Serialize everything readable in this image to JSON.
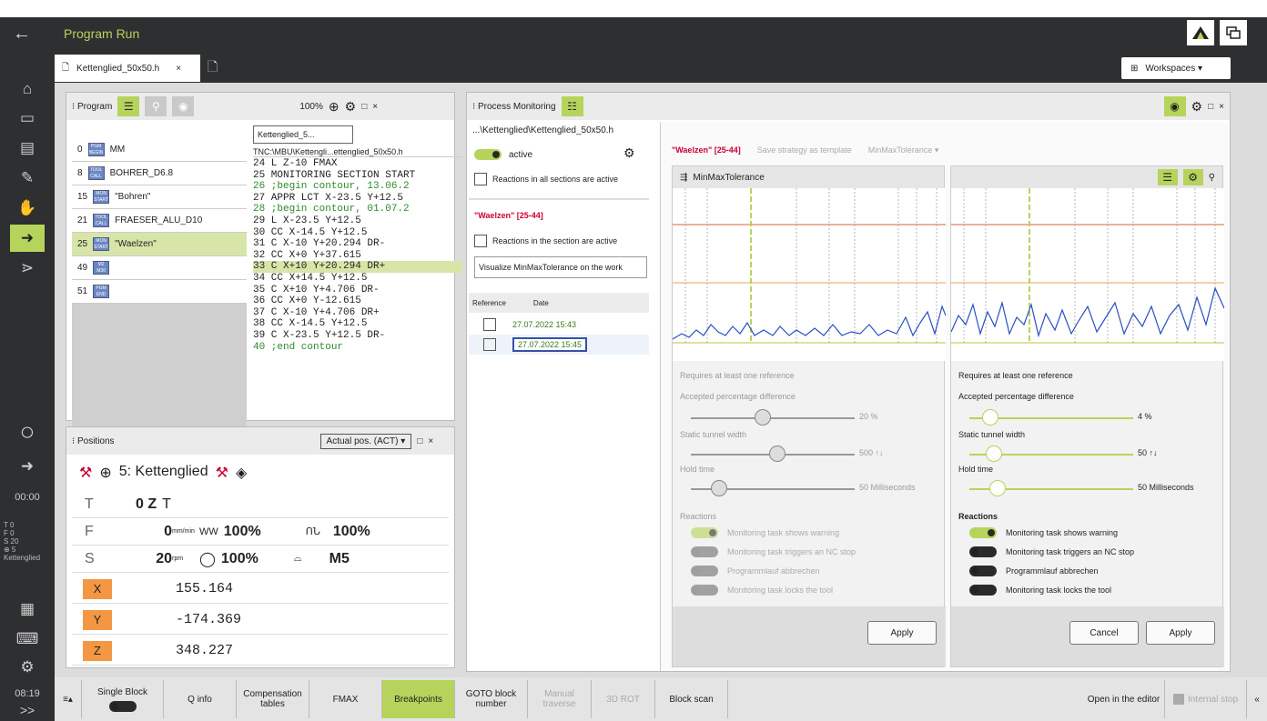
{
  "app": {
    "title": "Program Run",
    "back": "←"
  },
  "leftbar": {
    "time1": "00:00",
    "time2": "08:19",
    "time2_btn": ">>",
    "status": [
      "T  0",
      "F  0",
      "S  20",
      "⊕  5",
      "Kettenglied"
    ]
  },
  "tab": {
    "label": "Kettenglied_50x50.h",
    "close": "×"
  },
  "workspaces": "Workspaces ▾",
  "program": {
    "header": "⁝ Program",
    "zoom": "100%",
    "items": [
      {
        "num": "0",
        "badge": "PGM BEGIN",
        "label": "MM"
      },
      {
        "num": "8",
        "badge": "TOOL CALL",
        "label": "BOHRER_D6.8"
      },
      {
        "num": "15",
        "badge": "MON START",
        "label": "\"Bohren\""
      },
      {
        "num": "21",
        "badge": "TOOL CALL",
        "label": "FRAESER_ALU_D10"
      },
      {
        "num": "25",
        "badge": "MON START",
        "label": "\"Waelzen\""
      },
      {
        "num": "49",
        "badge": "M2 M30",
        "label": ""
      },
      {
        "num": "51",
        "badge": "PGM END",
        "label": ""
      }
    ],
    "breadcrumb": "Kettenglied_5...",
    "path": "TNC:\\MBU\\Kettengli...ettenglied_50x50.h",
    "lines": [
      "24 L Z-10 FMAX",
      "25 MONITORING SECTION START",
      "26 ;begin contour, 13.06.2",
      "27 APPR LCT X-23.5 Y+12.5 ",
      "28 ;begin contour, 01.07.2",
      "29 L X-23.5 Y+12.5",
      "30 CC X-14.5 Y+12.5",
      "31 C X-10 Y+20.294 DR-",
      "32 CC X+0 Y+37.615",
      "33 C X+10 Y+20.294 DR+",
      "34 CC X+14.5 Y+12.5",
      "35 C X+10 Y+4.706 DR-",
      "36 CC X+0 Y-12.615",
      "37 C X-10 Y+4.706 DR+",
      "38 CC X-14.5 Y+12.5",
      "39 C X-23.5 Y+12.5 DR-",
      "40 ;end contour"
    ]
  },
  "positions": {
    "header": "⁝ Positions",
    "mode": "Actual pos. (ACT) ▾",
    "tool": "5: Kettenglied",
    "T": {
      "label": "T",
      "value": "0 Z"
    },
    "F": {
      "label": "F",
      "value": "0",
      "unit": "mm/min",
      "ovr1": "100%",
      "ovr2": "100%"
    },
    "S": {
      "label": "S",
      "value": "20",
      "unit": "rpm",
      "ovr": "100%",
      "m": "M5"
    },
    "axes": [
      {
        "name": "X",
        "value": "155.164"
      },
      {
        "name": "Y",
        "value": "-174.369"
      },
      {
        "name": "Z",
        "value": "348.227"
      }
    ]
  },
  "pm": {
    "header": "⁝ Process Monitoring",
    "path": "...\\Kettenglied\\Kettenglied_50x50.h",
    "active": "active",
    "all_sections": "Reactions in all sections are active",
    "section": "\"Waelzen\" [25-44]",
    "section_active": "Reactions in the section are active",
    "visualize": "Visualize MinMaxTolerance on the work",
    "ref_header": "Reference",
    "date_header": "Date",
    "dates": [
      "27.07.2022 15:43",
      "27.07.2022 15:45"
    ],
    "strategy_title": "\"Waelzen\" [25-44]",
    "save_strategy": "Save strategy as template",
    "strategy": "MinMaxTolerance ▾",
    "chart_title": "MinMaxTolerance",
    "left": {
      "requires": "Requires at least one reference",
      "acc": "Accepted percentage difference",
      "acc_val": "20 %",
      "tunnel": "Static tunnel width",
      "tunnel_val": "500 ↑↓",
      "hold": "Hold time",
      "hold_val": "50 Milliseconds",
      "reactions": "Reactions",
      "r": [
        "Monitoring task shows warning",
        "Monitoring task triggers an NC stop",
        "Programmlauf abbrechen",
        "Monitoring task locks the tool"
      ],
      "apply": "Apply"
    },
    "right": {
      "requires": "Requires at least one reference",
      "acc": "Accepted percentage difference",
      "acc_val": "4 %",
      "tunnel": "Static tunnel width",
      "tunnel_val": "50 ↑↓",
      "hold": "Hold time",
      "hold_val": "50 Milliseconds",
      "reactions": "Reactions",
      "r": [
        "Monitoring task shows warning",
        "Monitoring task triggers an NC stop",
        "Programmlauf abbrechen",
        "Monitoring task locks the tool"
      ],
      "cancel": "Cancel",
      "apply": "Apply"
    }
  },
  "footer": {
    "menu": "≡▴",
    "single": "Single Block",
    "qinfo": "Q info",
    "comp": "Compensation tables",
    "fmax": "FMAX",
    "bp": "Breakpoints",
    "goto": "GOTO block number",
    "manual": "Manual traverse",
    "rot": "3D ROT",
    "scan": "Block scan",
    "editor": "Open in the editor",
    "istop": "Internal stop",
    "more": "«"
  }
}
